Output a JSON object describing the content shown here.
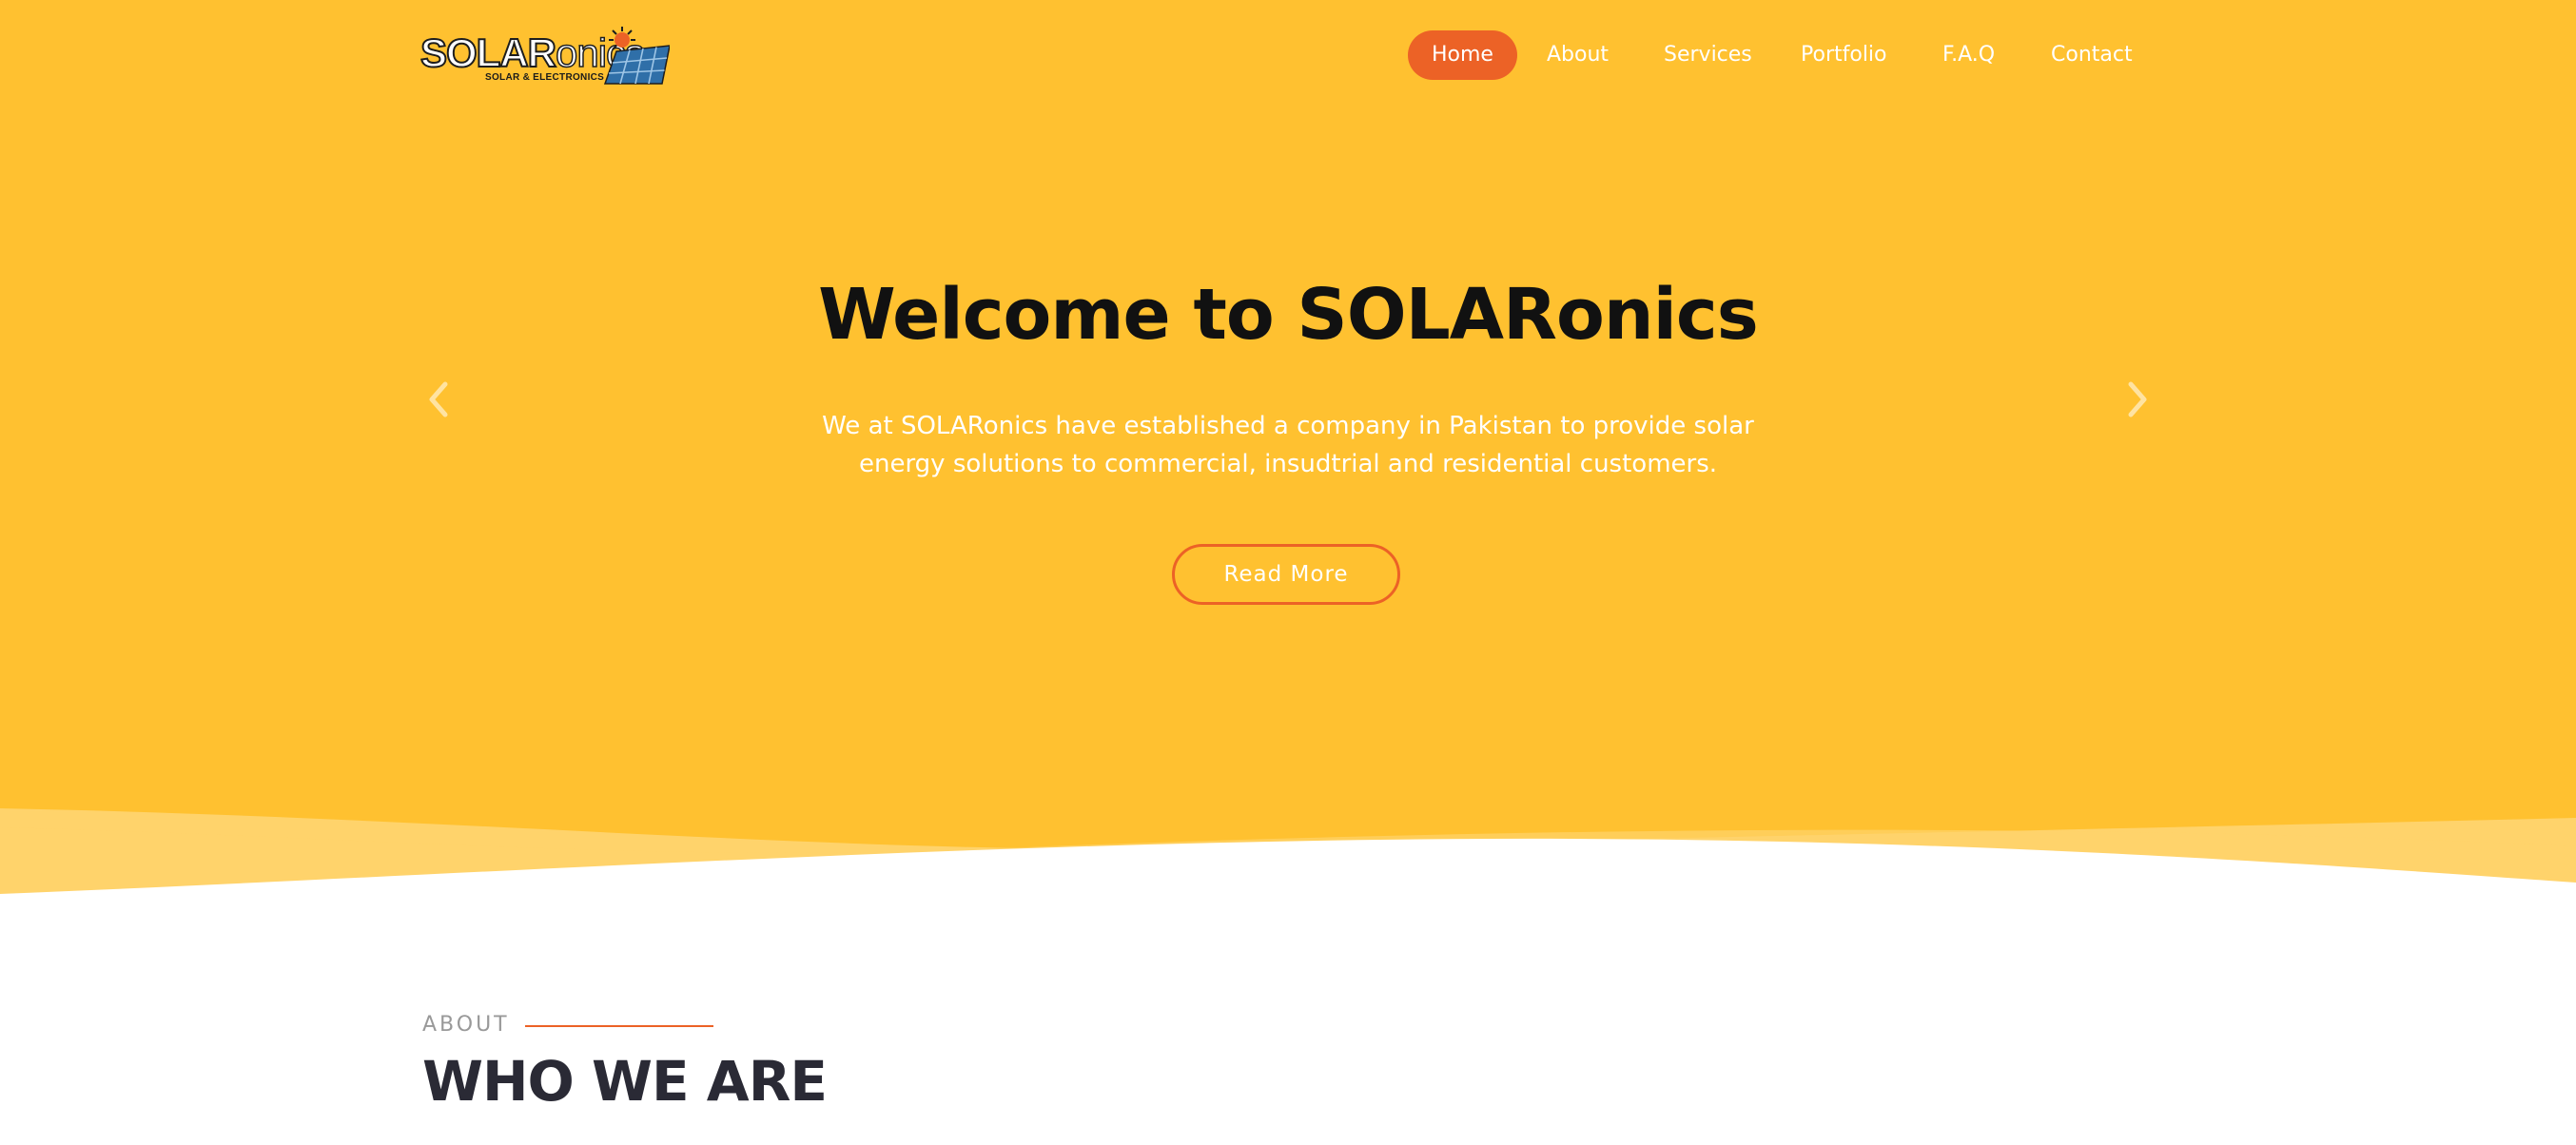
{
  "brand": {
    "logo_main": "SOLAR",
    "logo_suffix": "onics",
    "logo_tagline": "SOLAR & ELECTRONICS"
  },
  "nav": {
    "items": [
      {
        "label": "Home",
        "active": true
      },
      {
        "label": "About"
      },
      {
        "label": "Services"
      },
      {
        "label": "Portfolio"
      },
      {
        "label": "F.A.Q"
      },
      {
        "label": "Contact"
      }
    ]
  },
  "hero": {
    "title": "Welcome to SOLARonics",
    "text": "We at SOLARonics have established a company in Pakistan to provide solar energy solutions to commercial, insudtrial and residential customers.",
    "button_label": "Read More",
    "prev_icon": "chevron-left-icon",
    "next_icon": "chevron-right-icon"
  },
  "about": {
    "tag": "ABOUT",
    "title": "WHO WE ARE"
  },
  "colors": {
    "hero_bg": "#FFC130",
    "accent": "#EC6226",
    "wave_light": "#FFD36B",
    "title_dark": "#2a2a35"
  }
}
